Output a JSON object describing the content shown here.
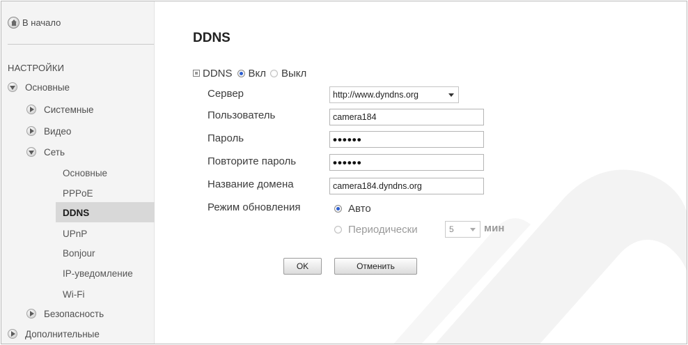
{
  "sidebar": {
    "home_label": "В начало",
    "section_header": "НАСТРОЙКИ",
    "items": [
      {
        "label": "Основные"
      },
      {
        "label": "Системные"
      },
      {
        "label": "Видео"
      },
      {
        "label": "Сеть"
      },
      {
        "label": "Основные"
      },
      {
        "label": "PPPoE"
      },
      {
        "label": "DDNS"
      },
      {
        "label": "UPnP"
      },
      {
        "label": "Bonjour"
      },
      {
        "label": "IP-уведомление"
      },
      {
        "label": "Wi-Fi"
      },
      {
        "label": "Безопасность"
      },
      {
        "label": "Дополнительные"
      }
    ],
    "active_item": "DDNS"
  },
  "main": {
    "title": "DDNS",
    "ddns_toggle": {
      "label": "DDNS",
      "on_label": "Вкл",
      "off_label": "Выкл",
      "selected": "Вкл"
    },
    "server": {
      "label": "Сервер",
      "value": "http://www.dyndns.org"
    },
    "user": {
      "label": "Пользователь",
      "value": "camera184"
    },
    "password": {
      "label": "Пароль",
      "value": "••••••"
    },
    "password_repeat": {
      "label": "Повторите пароль",
      "value": "••••••"
    },
    "domain": {
      "label": "Название домена",
      "value": "camera184.dyndns.org"
    },
    "update_mode": {
      "label": "Режим обновления",
      "auto_label": "Авто",
      "periodic_label": "Периодически",
      "selected": "Авто",
      "interval_value": "5",
      "interval_unit": "мин"
    },
    "buttons": {
      "ok": "OK",
      "cancel": "Отменить"
    }
  },
  "colors": {
    "accent_radio": "#2b5dcf",
    "active_nav_bg": "#d8d8d8",
    "sidebar_bg": "#f4f4f4"
  }
}
